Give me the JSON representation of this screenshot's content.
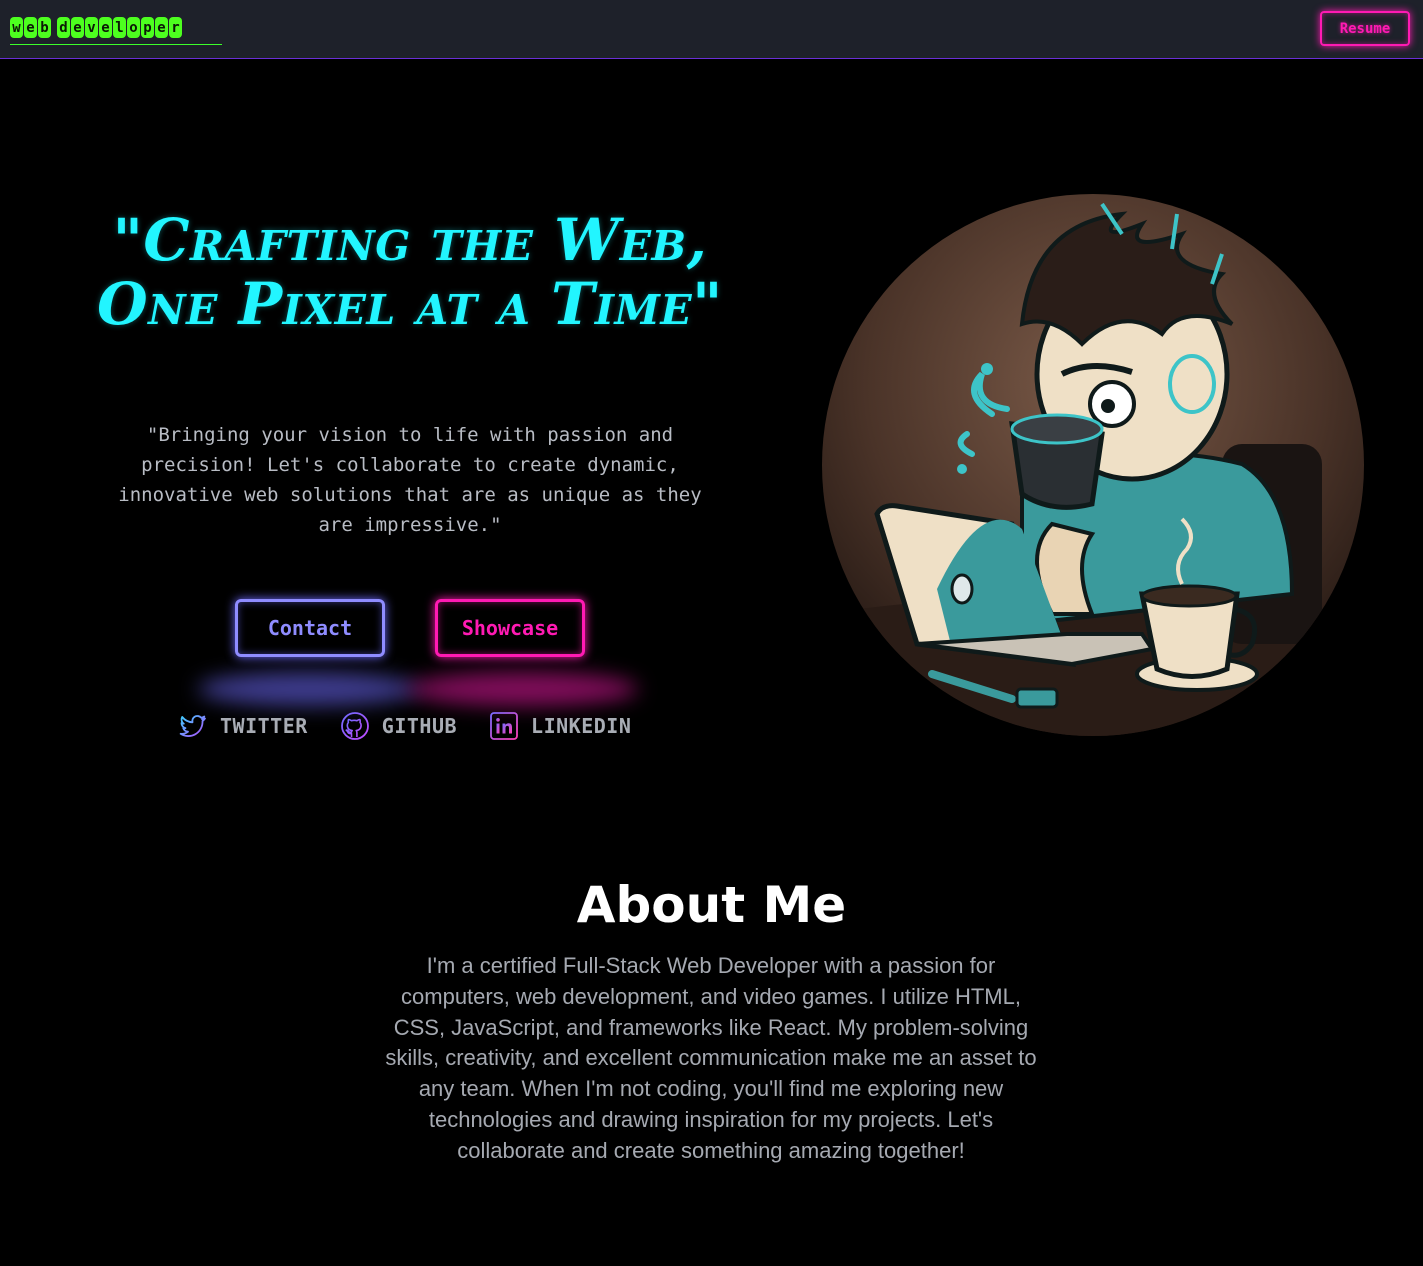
{
  "header": {
    "brand": "web developer",
    "resume_label": "Resume"
  },
  "hero": {
    "title_line1": "\"Crafting the Web,",
    "title_line2": "One Pixel at a Time\"",
    "subtitle": "\"Bringing your vision to life with passion and precision! Let's collaborate to create dynamic, innovative web solutions that are as unique as they are impressive.\"",
    "contact_label": "Contact",
    "showcase_label": "Showcase"
  },
  "socials": [
    {
      "label": "TWITTER",
      "icon": "twitter-icon"
    },
    {
      "label": "GITHUB",
      "icon": "github-icon"
    },
    {
      "label": "LINKEDIN",
      "icon": "linkedin-icon"
    }
  ],
  "about": {
    "title": "About Me",
    "text": "I'm a certified Full-Stack Web Developer with a passion for computers, web development, and video games. I utilize HTML, CSS, JavaScript, and frameworks like React. My problem-solving skills, creativity, and excellent communication make me an asset to any team. When I'm not coding, you'll find me exploring new technologies and drawing inspiration for my projects. Let's collaborate and create something amazing together!"
  },
  "colors": {
    "brand_green": "#4dff1f",
    "accent_pink": "#ff1ab3",
    "accent_cyan": "#22f5ff",
    "accent_purple": "#8f8cff",
    "nav_bg": "#1e212a"
  }
}
